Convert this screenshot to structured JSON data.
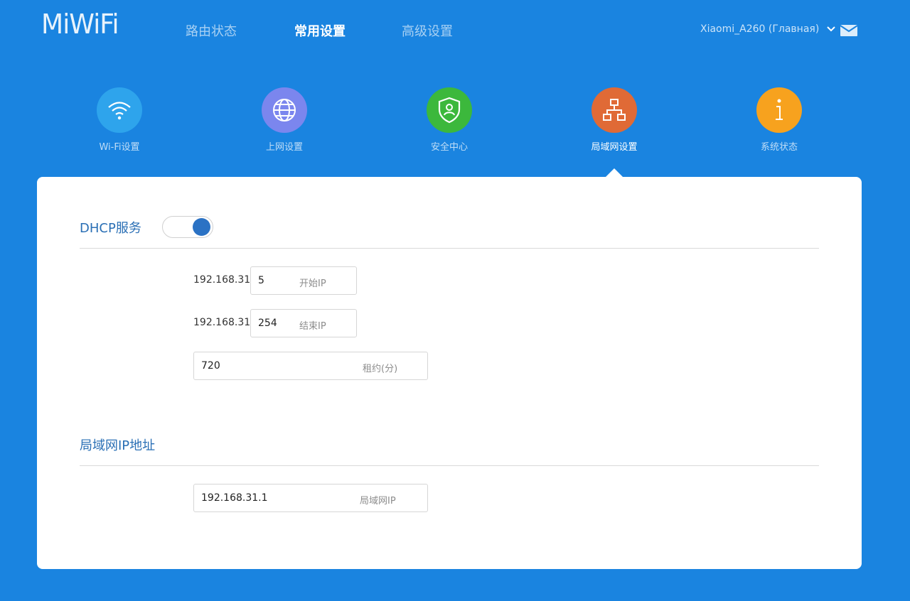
{
  "header": {
    "logo": "MiWiFi",
    "nav": [
      "路由状态",
      "常用设置",
      "高级设置"
    ],
    "active_nav": "常用设置",
    "account_label": "Xiaomi_A260 (Главная)",
    "icons": [
      "chevron-down-icon",
      "mail-icon"
    ]
  },
  "features": [
    {
      "label": "Wi-Fi设置",
      "icon": "wifi-icon",
      "color": "#2ea4ec"
    },
    {
      "label": "上网设置",
      "icon": "globe-icon",
      "color": "#7b86ee"
    },
    {
      "label": "安全中心",
      "icon": "shield-icon",
      "color": "#3cb83c"
    },
    {
      "label": "局域网设置",
      "icon": "network-icon",
      "color": "#e06a36",
      "active": true
    },
    {
      "label": "系统状态",
      "icon": "info-icon",
      "color": "#f7a21e"
    }
  ],
  "dhcp": {
    "title": "DHCP服务",
    "enabled": true,
    "ip_prefix": "192.168.31.",
    "start_ip": {
      "value": "5",
      "hint": "开始IP"
    },
    "end_ip": {
      "value": "254",
      "hint": "结束IP"
    },
    "lease": {
      "value": "720",
      "hint": "租约(分)"
    }
  },
  "lan": {
    "title": "局域网IP地址",
    "ip": {
      "value": "192.168.31.1",
      "hint": "局域网IP"
    }
  },
  "colors": {
    "background": "#1a84e0",
    "accent_blue": "#2a6fb5",
    "toggle_knob": "#2b72c4"
  }
}
